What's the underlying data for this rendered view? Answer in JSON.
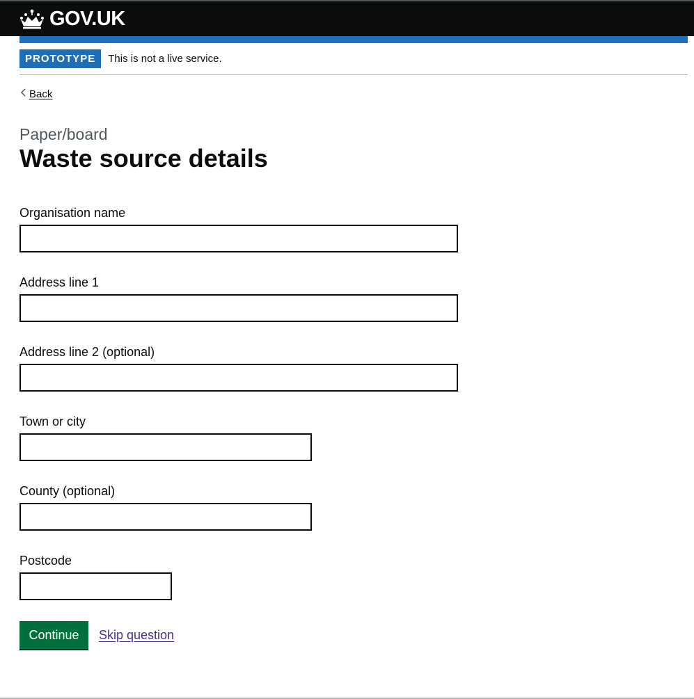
{
  "header": {
    "logo_text": "GOV.UK",
    "logo_icon": "crown-icon"
  },
  "phase_banner": {
    "tag": "PROTOTYPE",
    "text": "This is not a live service."
  },
  "back_link": "Back",
  "caption": "Paper/board",
  "title": "Waste source details",
  "fields": [
    {
      "label": "Organisation name",
      "value": ""
    },
    {
      "label": "Address line 1",
      "value": ""
    },
    {
      "label": "Address line 2 (optional)",
      "value": ""
    },
    {
      "label": "Town or city",
      "value": ""
    },
    {
      "label": "County (optional)",
      "value": ""
    },
    {
      "label": "Postcode",
      "value": ""
    }
  ],
  "actions": {
    "continue_label": "Continue",
    "skip_label": "Skip question"
  },
  "colors": {
    "header_bg": "#0b0c0c",
    "brand_blue": "#1d70b8",
    "button_green": "#00703c",
    "link_purple": "#4c2c92"
  }
}
